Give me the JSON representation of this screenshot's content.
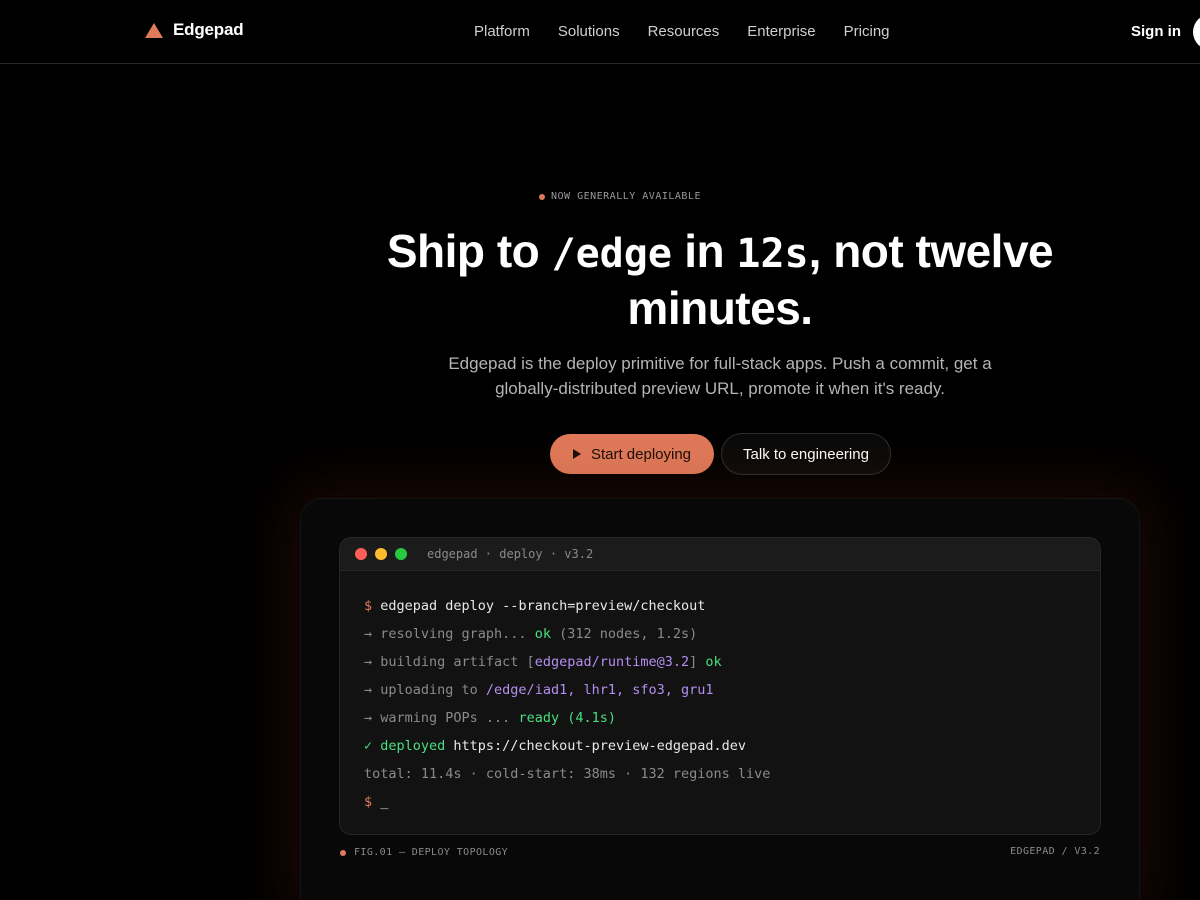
{
  "nav": {
    "brand": "Edgepad",
    "brand_icon": "triangle-logo-icon",
    "links": [
      "Platform",
      "Solutions",
      "Resources",
      "Enterprise",
      "Pricing"
    ],
    "sign_in": "Sign in"
  },
  "hero": {
    "badge": "NOW GENERALLY AVAILABLE",
    "headline_part1": "Ship to ",
    "headline_mono1": "/edge",
    "headline_part2": " in ",
    "headline_mono2": "12s",
    "headline_part3": ", not twelve minutes.",
    "subtitle": "Edgepad is the deploy primitive for full-stack apps. Push a commit, get a globally-distributed preview URL, promote it when it's ready.",
    "primary_button": "Start deploying",
    "secondary_button": "Talk to engineering"
  },
  "terminal": {
    "title": "edgepad · deploy · v3.2",
    "l1_prompt": "$",
    "l1_cmd": " edgepad deploy --branch=preview/checkout",
    "l2_a": "→ resolving graph... ",
    "l2_b": "ok",
    "l2_c": " (312 nodes, 1.2s)",
    "l3_a": "→ building artifact [",
    "l3_b": "edgepad/runtime@3.2",
    "l3_c": "] ",
    "l3_d": "ok",
    "l4_a": "→ uploading to ",
    "l4_b": "/edge/iad1, lhr1, sfo3, gru1",
    "l5_a": "→ warming POPs ... ",
    "l5_b": "ready (4.1s)",
    "l6_a": "✓ deployed",
    "l6_b": " https://checkout-preview-edgepad.dev",
    "l7": "total: 11.4s · cold-start: 38ms · 132 regions live",
    "l8_prompt": "$",
    "l8_cursor": " _"
  },
  "figure": {
    "caption_left": "FIG.01 — DEPLOY TOPOLOGY",
    "caption_right": "EDGEPAD / V3.2"
  },
  "colors": {
    "accent": "#e07a5a",
    "background": "#000000",
    "success": "#4ade80",
    "highlight": "#b48ef0"
  }
}
